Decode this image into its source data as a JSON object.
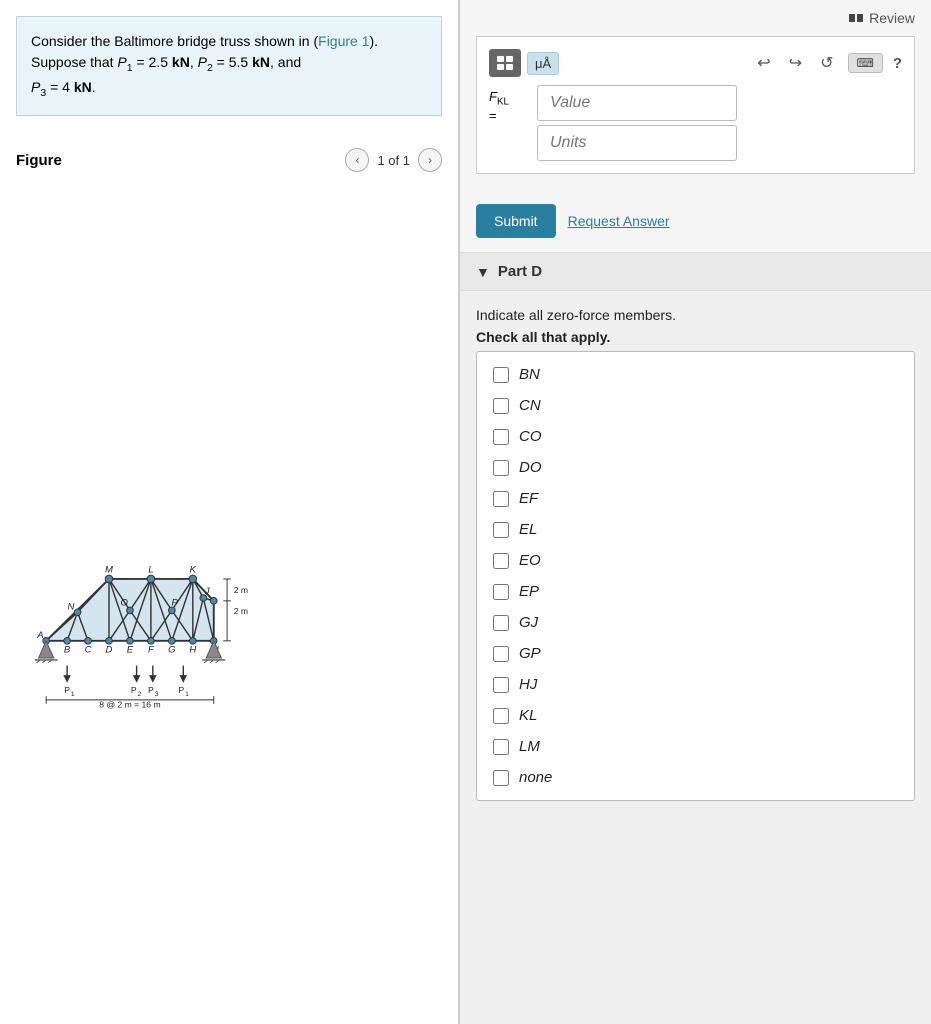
{
  "left": {
    "problem": {
      "text_1": "Consider the Baltimore bridge truss shown in (",
      "figure_link": "Figure 1",
      "text_2": ").",
      "line2": "Suppose that P",
      "sub1": "1",
      "text3": " = 2.5 kN, P",
      "sub2": "2",
      "text4": " = 5.5 kN, and",
      "line3_pre": "P",
      "sub3": "3",
      "text5": " = 4 kN."
    },
    "figure": {
      "title": "Figure",
      "nav_label": "1 of 1",
      "prev_btn": "‹",
      "next_btn": "›"
    }
  },
  "right": {
    "review_label": "Review",
    "widget": {
      "mu_label": "μÅ",
      "undo_icon": "↩",
      "redo_icon": "↪",
      "refresh_icon": "↺",
      "keyboard_label": "⌨",
      "help_label": "?",
      "f_label": "F",
      "subscript": "KL",
      "equals": "=",
      "value_placeholder": "Value",
      "units_placeholder": "Units"
    },
    "actions": {
      "submit_label": "Submit",
      "request_answer_label": "Request Answer"
    },
    "part_d": {
      "title": "Part D",
      "instruction": "Indicate all zero-force members.",
      "check_label": "Check all that apply.",
      "checkboxes": [
        {
          "id": "BN",
          "label": "BN"
        },
        {
          "id": "CN",
          "label": "CN"
        },
        {
          "id": "CO",
          "label": "CO"
        },
        {
          "id": "DO",
          "label": "DO"
        },
        {
          "id": "EF",
          "label": "EF"
        },
        {
          "id": "EL",
          "label": "EL"
        },
        {
          "id": "EO",
          "label": "EO"
        },
        {
          "id": "EP",
          "label": "EP"
        },
        {
          "id": "GJ",
          "label": "GJ"
        },
        {
          "id": "GP",
          "label": "GP"
        },
        {
          "id": "HJ",
          "label": "HJ"
        },
        {
          "id": "KL",
          "label": "KL"
        },
        {
          "id": "LM",
          "label": "LM"
        },
        {
          "id": "none",
          "label": "none"
        }
      ]
    }
  }
}
